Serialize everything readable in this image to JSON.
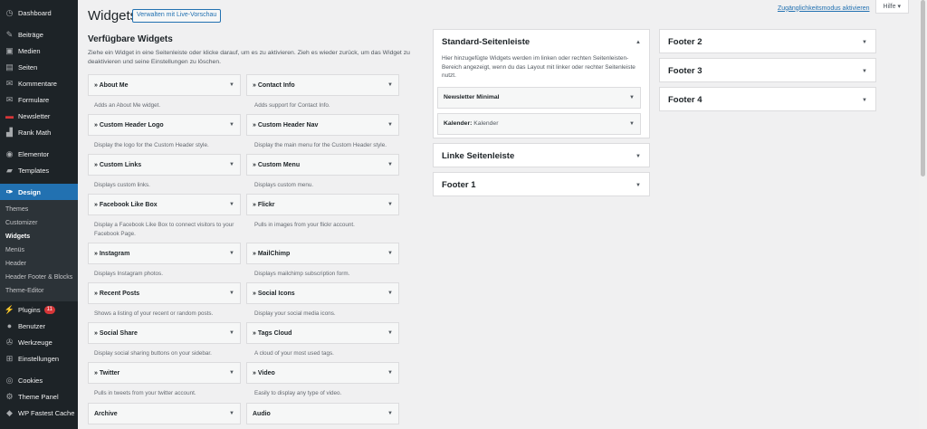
{
  "menu": {
    "dashboard": "Dashboard",
    "beitraege": "Beiträge",
    "medien": "Medien",
    "seiten": "Seiten",
    "kommentare": "Kommentare",
    "formulare": "Formulare",
    "newsletter": "Newsletter",
    "rankmath": "Rank Math",
    "elementor": "Elementor",
    "templates": "Templates",
    "design": "Design",
    "sub": {
      "themes": "Themes",
      "customizer": "Customizer",
      "widgets": "Widgets",
      "menus": "Menüs",
      "header": "Header",
      "headerfooter": "Header Footer & Blocks",
      "themeeditor": "Theme-Editor"
    },
    "plugins": "Plugins",
    "plugins_badge": "11",
    "benutzer": "Benutzer",
    "werkzeuge": "Werkzeuge",
    "einstellungen": "Einstellungen",
    "cookies": "Cookies",
    "themepanel": "Theme Panel",
    "wpfastest": "WP Fastest Cache"
  },
  "top": {
    "accessibility_link": "Zugänglichkeitsmodus aktivieren",
    "help": "Hilfe"
  },
  "header": {
    "title": "Widgets",
    "live_button": "Verwalten mit Live-Vorschau"
  },
  "available": {
    "heading": "Verfügbare Widgets",
    "description": "Ziehe ein Widget in eine Seitenleiste oder klicke darauf, um es zu aktivieren. Zieh es wieder zurück, um das Widget zu deaktivieren und seine Einstellungen zu löschen.",
    "widgets": [
      {
        "title": "» About Me",
        "desc": "Adds an About Me widget."
      },
      {
        "title": "» Contact Info",
        "desc": "Adds support for Contact Info."
      },
      {
        "title": "» Custom Header Logo",
        "desc": "Display the logo for the Custom Header style."
      },
      {
        "title": "» Custom Header Nav",
        "desc": "Display the main menu for the Custom Header style."
      },
      {
        "title": "» Custom Links",
        "desc": "Displays custom links."
      },
      {
        "title": "» Custom Menu",
        "desc": "Displays custom menu."
      },
      {
        "title": "» Facebook Like Box",
        "desc": "Display a Facebook Like Box to connect visitors to your Facebook Page."
      },
      {
        "title": "» Flickr",
        "desc": "Pulls in images from your flickr account."
      },
      {
        "title": "» Instagram",
        "desc": "Displays Instagram photos."
      },
      {
        "title": "» MailChimp",
        "desc": "Displays mailchimp subscription form."
      },
      {
        "title": "» Recent Posts",
        "desc": "Shows a listing of your recent or random posts."
      },
      {
        "title": "» Social Icons",
        "desc": "Display your social media icons."
      },
      {
        "title": "» Social Share",
        "desc": "Display social sharing buttons on your sidebar."
      },
      {
        "title": "» Tags Cloud",
        "desc": "A cloud of your most used tags."
      },
      {
        "title": "» Twitter",
        "desc": "Pulls in tweets from your twitter account."
      },
      {
        "title": "» Video",
        "desc": "Easily to display any type of video."
      },
      {
        "title": "Archive",
        "desc": ""
      },
      {
        "title": "Audio",
        "desc": ""
      }
    ]
  },
  "areas": {
    "standard": {
      "title": "Standard-Seitenleiste",
      "desc": "Hier hinzugefügte Widgets werden im linken oder rechten Seitenleisten-Bereich angezeigt, wenn du das Layout mit linker oder rechter Seitenleiste nutzt.",
      "widget1": "Newsletter Minimal",
      "widget2_title": "Kalender:",
      "widget2_sub": "Kalender"
    },
    "linke": "Linke Seitenleiste",
    "footer1": "Footer 1",
    "footer2": "Footer 2",
    "footer3": "Footer 3",
    "footer4": "Footer 4"
  }
}
